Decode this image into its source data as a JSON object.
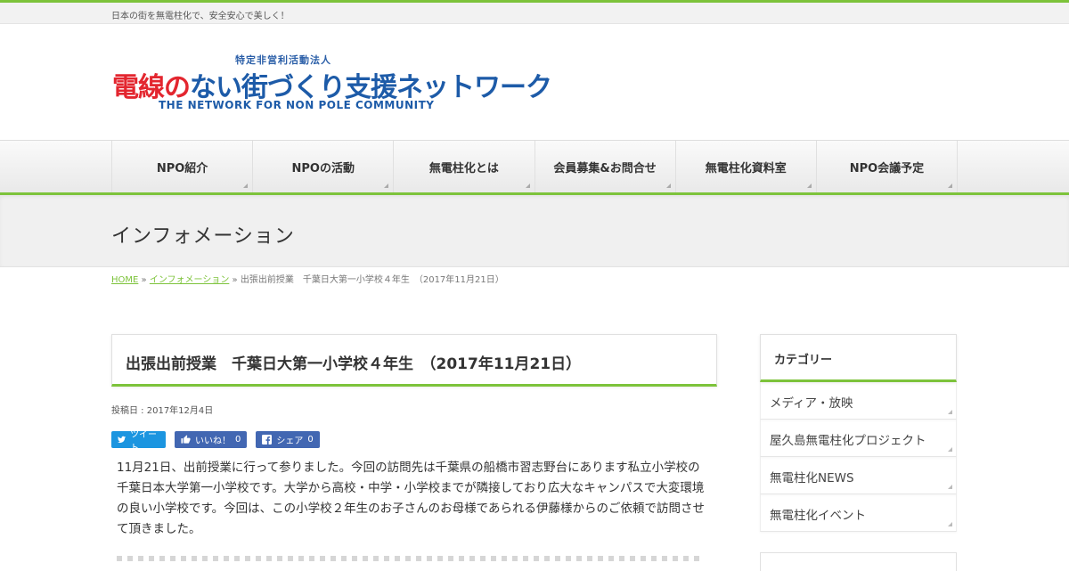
{
  "site": {
    "tagline": "日本の街を無電柱化で、安全安心で美しく！",
    "logo": {
      "sub": "特定非営利活動法人",
      "main_a": "電線",
      "main_b": "の",
      "main_c": "ない街づくり支援ネットワーク",
      "en": "THE NETWORK FOR NON POLE COMMUNITY"
    }
  },
  "nav": {
    "items": [
      {
        "label": "NPO紹介"
      },
      {
        "label": "NPOの活動"
      },
      {
        "label": "無電柱化とは"
      },
      {
        "label": "会員募集&お問合せ"
      },
      {
        "label": "無電柱化資料室"
      },
      {
        "label": "NPO会議予定"
      }
    ]
  },
  "page": {
    "title": "インフォメーション"
  },
  "breadcrumb": {
    "home": "HOME",
    "sep": "»",
    "section": "インフォメーション",
    "current": "出張出前授業　千葉日大第一小学校４年生　（2017年11月21日）"
  },
  "post": {
    "title": "出張出前授業　千葉日大第一小学校４年生　（2017年11月21日）",
    "date": "投稿日 : 2017年12月4日",
    "share": {
      "tweet": "ツイート",
      "like": "いいね！",
      "like_count": "0",
      "share": "シェア",
      "share_count": "0"
    },
    "body": "11月21日、出前授業に行って参りました。今回の訪問先は千葉県の船橋市習志野台にあります私立小学校の千葉日本大学第一小学校です。大学から高校・中学・小学校までが隣接しており広大なキャンパスで大変環境の良い小学校です。今回は、この小学校２年生のお子さんのお母様であられる伊藤様からのご依頼で訪問させて頂きました。"
  },
  "sidebar": {
    "heading": "カテゴリー",
    "items": [
      {
        "label": "メディア・放映"
      },
      {
        "label": "屋久島無電柱化プロジェクト"
      },
      {
        "label": "無電柱化NEWS"
      },
      {
        "label": "無電柱化イベント"
      }
    ]
  },
  "colors": {
    "accent": "#7dc33b",
    "twitter": "#1b95e0",
    "facebook": "#4267b2"
  }
}
